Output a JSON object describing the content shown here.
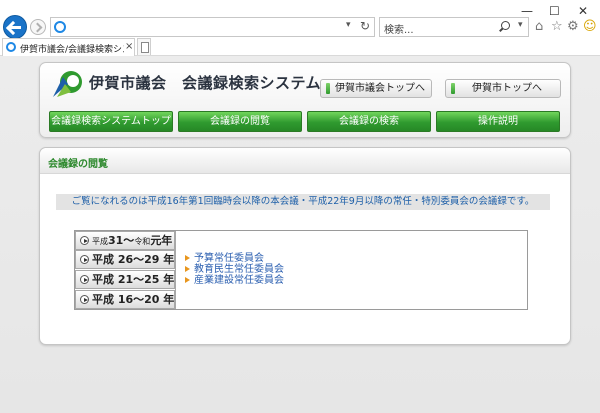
{
  "browser": {
    "address_value": "",
    "search_placeholder": "検索...",
    "tab_title": "伊賀市議会/会議録検索シス...",
    "tab_close": "×",
    "addr_drop": "▾",
    "addr_refresh": "↻",
    "search_drop": "▾",
    "min": "—",
    "max": "☐",
    "close": "✕",
    "home_glyph": "⌂",
    "star_glyph": "☆",
    "gear_glyph": "⚙",
    "smiley_glyph": "☺"
  },
  "header": {
    "site_title": "伊賀市議会　会議録検索システム",
    "link_council_top": "伊賀市議会トップへ",
    "link_city_top": "伊賀市トップへ"
  },
  "nav": [
    {
      "label": "会議録検索システムトップ"
    },
    {
      "label": "会議録の閲覧"
    },
    {
      "label": "会議録の検索"
    },
    {
      "label": "操作説明"
    }
  ],
  "content": {
    "title": "会議録の閲覧",
    "notice": "ご覧になれるのは平成16年第1回臨時会以降の本会議・平成22年9月以降の常任・特別委員会の会議録です。",
    "eras": [
      {
        "pre": "平成",
        "mid": "31～",
        "small": "令和",
        "post": "元年"
      },
      {
        "label": "平成 26～29 年"
      },
      {
        "label": "平成 21～25 年"
      },
      {
        "label": "平成 16～20 年"
      }
    ],
    "committees": [
      {
        "label": "予算常任委員会"
      },
      {
        "label": "教育民生常任委員会"
      },
      {
        "label": "産業建設常任委員会"
      }
    ]
  },
  "colors": {
    "nav_green": "#2f9a2f",
    "link_blue": "#2b5fb0",
    "notice_blue": "#1d5fa8",
    "title_green": "#2f8a2f"
  }
}
